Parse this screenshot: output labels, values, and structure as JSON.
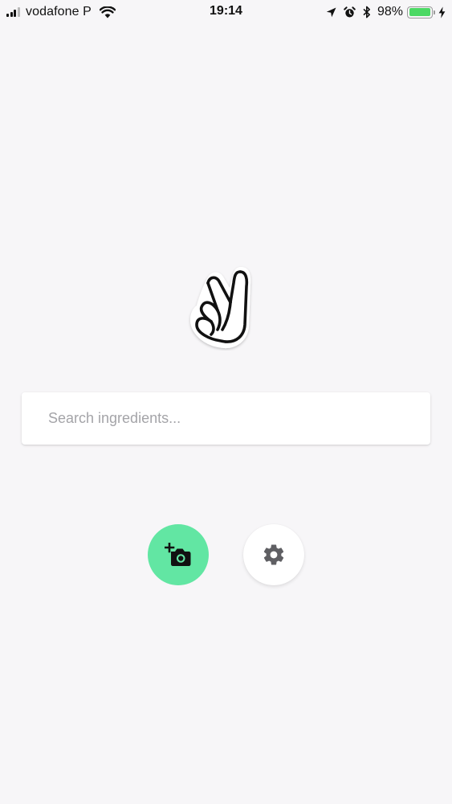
{
  "status_bar": {
    "carrier": "vodafone P",
    "time": "19:14",
    "battery_percent": "98%",
    "battery_level": 0.98,
    "icons": [
      "signal-icon",
      "wifi-icon",
      "location-arrow-icon",
      "alarm-icon",
      "bluetooth-icon",
      "battery-icon",
      "charging-bolt-icon"
    ]
  },
  "logo": {
    "icon": "peace-hand-logo-icon"
  },
  "search": {
    "placeholder": "Search ingredients...",
    "value": ""
  },
  "actions": {
    "camera": {
      "icon": "add-camera-icon",
      "color": "#62e6a3"
    },
    "settings": {
      "icon": "gear-icon",
      "color": "#ffffff"
    }
  },
  "colors": {
    "background": "#f7f6f8",
    "accent": "#62e6a3",
    "battery": "#4cd964"
  }
}
